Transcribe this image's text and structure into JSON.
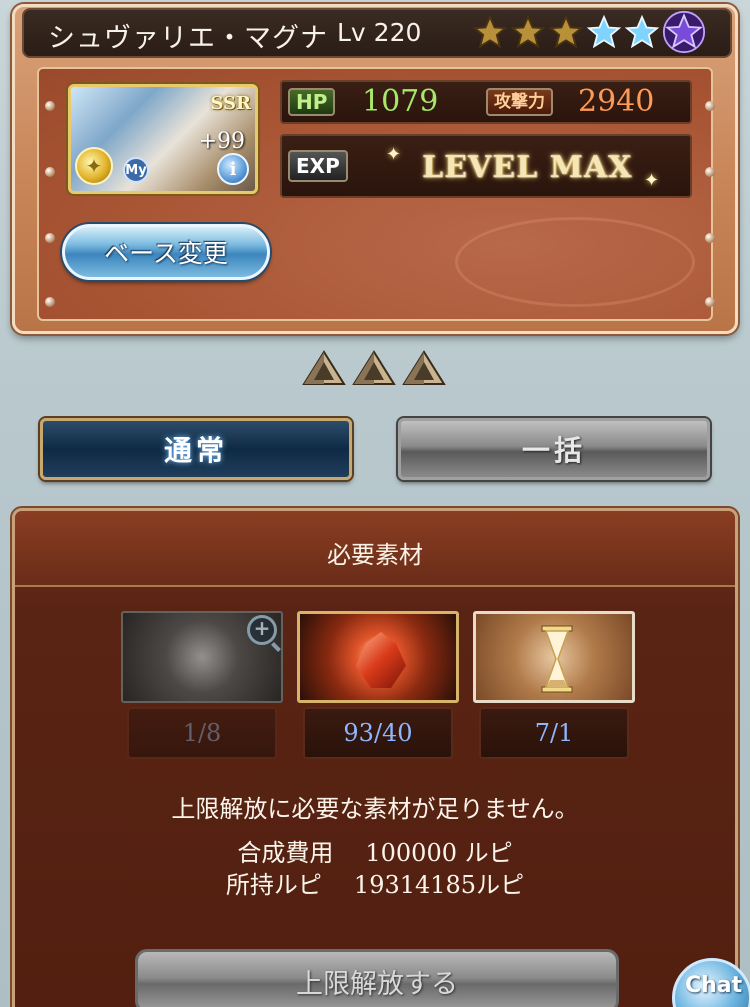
{
  "character": {
    "name": "シュヴァリエ・マグナ",
    "level": "Lv 220",
    "rarity": "SSR",
    "plus": "+99",
    "my_badge": "My",
    "stars_total": 6,
    "stars_gold": 3,
    "stars_blue": 2,
    "stars_purple": 1,
    "hp_label": "HP",
    "hp": "1079",
    "atk_label": "攻撃力",
    "atk": "2940",
    "exp_label": "EXP",
    "exp_value": "LEVEL MAX",
    "base_change_label": "ベース変更"
  },
  "uncap_level": 3,
  "tabs": [
    {
      "label": "通常",
      "active": true
    },
    {
      "label": "一括",
      "active": false
    }
  ],
  "materials": {
    "title": "必要素材",
    "items": [
      {
        "icon": "weapon-orb-icon",
        "count": "1/8",
        "sufficient": false
      },
      {
        "icon": "fire-crystal-icon",
        "count": "93/40",
        "sufficient": true
      },
      {
        "icon": "hourglass-icon",
        "count": "7/1",
        "sufficient": true
      }
    ],
    "warning": "上限解放に必要な素材が足りません。",
    "cost_label": "合成費用",
    "cost_value": "100000 ルピ",
    "owned_label": "所持ルピ",
    "owned_value": "19314185ルピ",
    "uncap_button": "上限解放する"
  },
  "chat_label": "Chat",
  "colors": {
    "hp": "#a7e86a",
    "atk": "#ff9a55",
    "count": "#8fb5ff"
  }
}
